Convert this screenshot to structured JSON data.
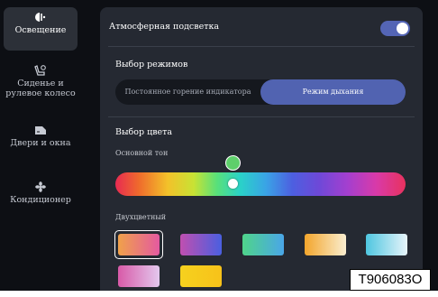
{
  "sidebar": {
    "items": [
      {
        "label": "Освещение",
        "icon": "light-icon",
        "active": true
      },
      {
        "label": "Сиденье и рулевое колесо",
        "icon": "seat-icon",
        "active": false
      },
      {
        "label": "Двери и окна",
        "icon": "door-icon",
        "active": false
      },
      {
        "label": "Кондиционер",
        "icon": "fan-icon",
        "active": false
      }
    ]
  },
  "panel": {
    "ambient_label": "Атмосферная подсветка",
    "ambient_on": true,
    "mode_title": "Выбор режимов",
    "modes": [
      {
        "label": "Постоянное горение индикатора",
        "selected": false
      },
      {
        "label": "Режим дыхания",
        "selected": true
      }
    ],
    "color_title": "Выбор цвета",
    "base_tone_label": "Основной тон",
    "base_tone_color": "#5ecf6b",
    "two_tone_label": "Двухцветный",
    "swatches": [
      {
        "name": "orange-pink",
        "from": "#f0a14a",
        "to": "#e45aa0",
        "selected": true
      },
      {
        "name": "magenta-blue",
        "from": "#c04fb0",
        "to": "#4a5fe0",
        "selected": false
      },
      {
        "name": "green-blue",
        "from": "#4fd48a",
        "to": "#4aa6e8",
        "selected": false
      },
      {
        "name": "orange-cream",
        "from": "#f3a52c",
        "to": "#faeed0",
        "selected": false
      },
      {
        "name": "cyan-white",
        "from": "#4ec6e0",
        "to": "#e8f4fa",
        "selected": false
      },
      {
        "name": "pink-purple",
        "from": "#d85aa8",
        "to": "#e3c8ee",
        "selected": false
      },
      {
        "name": "yellow",
        "from": "#f6d11e",
        "to": "#f7c21a",
        "selected": false
      }
    ]
  },
  "watermark": "T906083O"
}
